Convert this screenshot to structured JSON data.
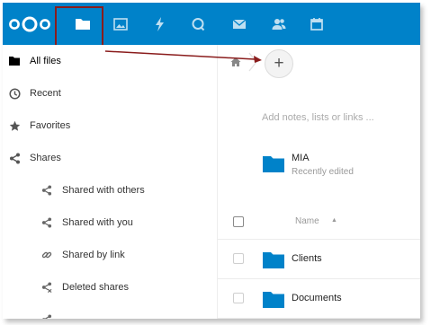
{
  "nav": {
    "all_files": "All files",
    "recent": "Recent",
    "favorites": "Favorites",
    "shares": "Shares",
    "shared_with_others": "Shared with others",
    "shared_with_you": "Shared with you",
    "shared_by_link": "Shared by link",
    "deleted_shares": "Deleted shares"
  },
  "content": {
    "notes_placeholder": "Add notes, lists or links ...",
    "plus_label": "+",
    "recent_item": {
      "name": "MIA",
      "subtitle": "Recently edited"
    },
    "name_header": "Name",
    "sort_indicator": "▲",
    "files": [
      "Clients",
      "Documents"
    ]
  },
  "colors": {
    "brand": "#0082c9",
    "folder": "#0082c9",
    "annotation": "#8a1c1c"
  }
}
